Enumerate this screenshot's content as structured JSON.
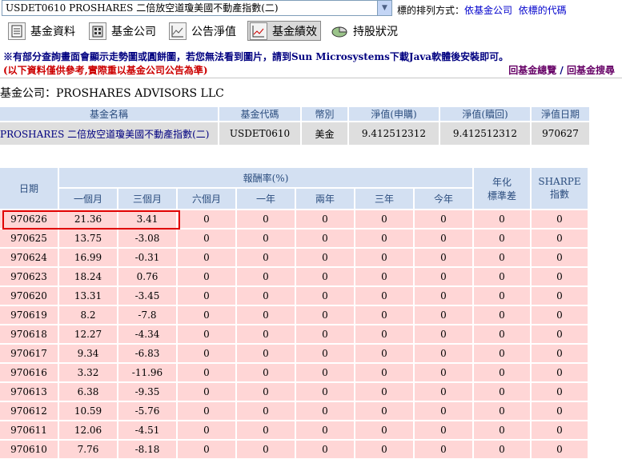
{
  "fund_select": {
    "value": "USDET0610    PROSHARES 二倍放空道瓊美國不動產指數(二)"
  },
  "sort": {
    "label": "標的排列方式：",
    "by_company": "依基金公司",
    "by_code": "依標的代碼"
  },
  "toolbar": {
    "fund_info": "基金資料",
    "fund_company": "基金公司",
    "nav_notice": "公告淨值",
    "performance": "基金績效",
    "holdings": "持股狀況"
  },
  "notices": {
    "line1": "※有部分查詢畫面會顯示走勢圖或圓餅圖，若您無法看到圖片，請到Sun Microsystems下載Java軟體後安裝即可。",
    "line2": "(以下資料僅供參考,實際重以基金公司公告為準)"
  },
  "nav_links": {
    "overview": "回基金總覽",
    "sep": " / ",
    "search": "回基金搜尋"
  },
  "company": {
    "label": "基金公司：",
    "name": "PROSHARES ADVISORS LLC"
  },
  "info_table": {
    "headers": [
      "基金名稱",
      "基金代碼",
      "幣別",
      "淨值(申購)",
      "淨值(贖回)",
      "淨值日期"
    ],
    "row": [
      "PROSHARES 二倍放空道瓊美國不動產指數(二)",
      "USDET0610",
      "美金",
      "9.412512312",
      "9.412512312",
      "970627"
    ]
  },
  "perf_table": {
    "date_header": "日期",
    "return_header": "報酬率(%)",
    "period_headers": [
      "一個月",
      "三個月",
      "六個月",
      "一年",
      "兩年",
      "三年",
      "今年"
    ],
    "std_header": [
      "年化",
      "標準差"
    ],
    "sharpe_header": [
      "SHARPE",
      "指數"
    ],
    "rows": [
      [
        "970626",
        "21.36",
        "3.41",
        "0",
        "0",
        "0",
        "0",
        "0",
        "0",
        "0"
      ],
      [
        "970625",
        "13.75",
        "-3.08",
        "0",
        "0",
        "0",
        "0",
        "0",
        "0",
        "0"
      ],
      [
        "970624",
        "16.99",
        "-0.31",
        "0",
        "0",
        "0",
        "0",
        "0",
        "0",
        "0"
      ],
      [
        "970623",
        "18.24",
        "0.76",
        "0",
        "0",
        "0",
        "0",
        "0",
        "0",
        "0"
      ],
      [
        "970620",
        "13.31",
        "-3.45",
        "0",
        "0",
        "0",
        "0",
        "0",
        "0",
        "0"
      ],
      [
        "970619",
        "8.2",
        "-7.8",
        "0",
        "0",
        "0",
        "0",
        "0",
        "0",
        "0"
      ],
      [
        "970618",
        "12.27",
        "-4.34",
        "0",
        "0",
        "0",
        "0",
        "0",
        "0",
        "0"
      ],
      [
        "970617",
        "9.34",
        "-6.83",
        "0",
        "0",
        "0",
        "0",
        "0",
        "0",
        "0"
      ],
      [
        "970616",
        "3.32",
        "-11.96",
        "0",
        "0",
        "0",
        "0",
        "0",
        "0",
        "0"
      ],
      [
        "970613",
        "6.38",
        "-9.35",
        "0",
        "0",
        "0",
        "0",
        "0",
        "0",
        "0"
      ],
      [
        "970612",
        "10.59",
        "-5.76",
        "0",
        "0",
        "0",
        "0",
        "0",
        "0",
        "0"
      ],
      [
        "970611",
        "12.06",
        "-4.51",
        "0",
        "0",
        "0",
        "0",
        "0",
        "0",
        "0"
      ],
      [
        "970610",
        "7.76",
        "-8.18",
        "0",
        "0",
        "0",
        "0",
        "0",
        "0",
        "0"
      ]
    ]
  },
  "colors": {
    "header_bg": "#d3e0f2",
    "row_bg": "#ffd6d6",
    "highlight": "#e00000",
    "notice_red": "#cc0000"
  }
}
